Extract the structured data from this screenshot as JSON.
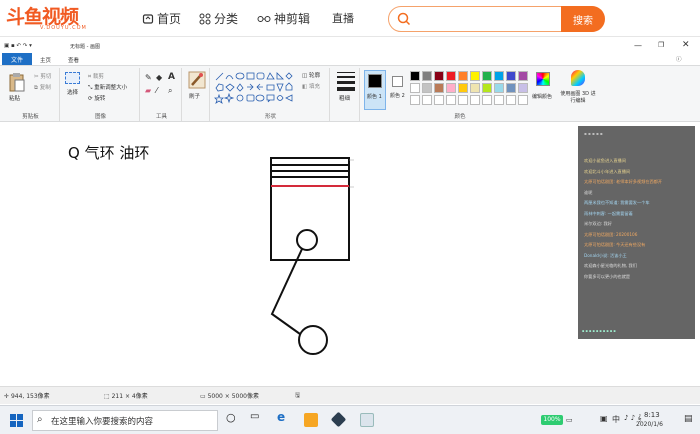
{
  "site": {
    "logo_text": "斗鱼视频",
    "logo_sub": "V.DOUYU.COM",
    "nav": [
      "首页",
      "分类",
      "神剪辑",
      "直播"
    ],
    "search_placeholder": "",
    "search_button": "搜索"
  },
  "paint": {
    "title": "无标题 - 画图",
    "tabs": [
      "文件",
      "主页",
      "查看"
    ],
    "groups": {
      "clipboard": {
        "label": "剪贴板",
        "paste": "粘贴",
        "cut": "剪切",
        "copy": "复制"
      },
      "image": {
        "label": "图像",
        "select": "选择",
        "crop": "裁剪",
        "resize": "重新调整大小",
        "rotate": "旋转"
      },
      "tools": {
        "label": "工具"
      },
      "shapes": {
        "label": "形状",
        "brush": "刷子",
        "outline": "轮廓",
        "fill": "填充"
      },
      "size": {
        "label": "粗细"
      },
      "colors": {
        "label": "颜色",
        "color1": "颜色 1",
        "color2": "颜色 2",
        "edit": "编辑颜色",
        "paint3d": "使用画图 3D 进行编辑"
      }
    },
    "palette": [
      "#000000",
      "#7f7f7f",
      "#880015",
      "#ed1c24",
      "#ff7f27",
      "#fff200",
      "#22b14c",
      "#00a2e8",
      "#3f48cc",
      "#a349a4",
      "#ffffff",
      "#c3c3c3",
      "#b97a57",
      "#ffaec9",
      "#ffc90e",
      "#efe4b0",
      "#b5e61d",
      "#99d9ea",
      "#7092be",
      "#c8bfe7"
    ],
    "canvas": {
      "annotation": "Q 气环 油环"
    },
    "status": {
      "cursor": "944, 153像素",
      "selection": "211 × 4像素",
      "size": "5000 × 5000像素"
    },
    "chat_lines": [
      "欢迎小鲨鱼进入直播间",
      "欢迎北斗小年进入直播间",
      "太原可怕话剧团: 老师本好多视频在西都开",
      "谁呢",
      "两厘米我也不知道: 我需要发一个车",
      "雨林中刺客: 一起需要留着",
      "米尔双边: 我好",
      "太原可怕话剧团: 20200106",
      "太原可怕话剧团: 今天还有些没有",
      "Donald小说: 活该小王",
      "欢迎森小星光临的礼物, 我们",
      "你要多可以更小的也就是"
    ]
  },
  "taskbar": {
    "search_text": "在这里输入你要搜索的内容",
    "battery": "100%",
    "ime": "中",
    "time": "8:13",
    "date": "2020/1/6"
  }
}
